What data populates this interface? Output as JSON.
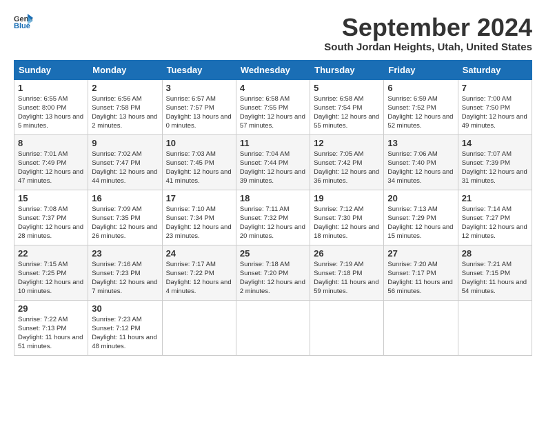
{
  "header": {
    "logo_general": "General",
    "logo_blue": "Blue",
    "month_title": "September 2024",
    "location": "South Jordan Heights, Utah, United States"
  },
  "weekdays": [
    "Sunday",
    "Monday",
    "Tuesday",
    "Wednesday",
    "Thursday",
    "Friday",
    "Saturday"
  ],
  "weeks": [
    [
      {
        "day": "1",
        "sunrise": "6:55 AM",
        "sunset": "8:00 PM",
        "daylight": "13 hours and 5 minutes."
      },
      {
        "day": "2",
        "sunrise": "6:56 AM",
        "sunset": "7:58 PM",
        "daylight": "13 hours and 2 minutes."
      },
      {
        "day": "3",
        "sunrise": "6:57 AM",
        "sunset": "7:57 PM",
        "daylight": "13 hours and 0 minutes."
      },
      {
        "day": "4",
        "sunrise": "6:58 AM",
        "sunset": "7:55 PM",
        "daylight": "12 hours and 57 minutes."
      },
      {
        "day": "5",
        "sunrise": "6:58 AM",
        "sunset": "7:54 PM",
        "daylight": "12 hours and 55 minutes."
      },
      {
        "day": "6",
        "sunrise": "6:59 AM",
        "sunset": "7:52 PM",
        "daylight": "12 hours and 52 minutes."
      },
      {
        "day": "7",
        "sunrise": "7:00 AM",
        "sunset": "7:50 PM",
        "daylight": "12 hours and 49 minutes."
      }
    ],
    [
      {
        "day": "8",
        "sunrise": "7:01 AM",
        "sunset": "7:49 PM",
        "daylight": "12 hours and 47 minutes."
      },
      {
        "day": "9",
        "sunrise": "7:02 AM",
        "sunset": "7:47 PM",
        "daylight": "12 hours and 44 minutes."
      },
      {
        "day": "10",
        "sunrise": "7:03 AM",
        "sunset": "7:45 PM",
        "daylight": "12 hours and 41 minutes."
      },
      {
        "day": "11",
        "sunrise": "7:04 AM",
        "sunset": "7:44 PM",
        "daylight": "12 hours and 39 minutes."
      },
      {
        "day": "12",
        "sunrise": "7:05 AM",
        "sunset": "7:42 PM",
        "daylight": "12 hours and 36 minutes."
      },
      {
        "day": "13",
        "sunrise": "7:06 AM",
        "sunset": "7:40 PM",
        "daylight": "12 hours and 34 minutes."
      },
      {
        "day": "14",
        "sunrise": "7:07 AM",
        "sunset": "7:39 PM",
        "daylight": "12 hours and 31 minutes."
      }
    ],
    [
      {
        "day": "15",
        "sunrise": "7:08 AM",
        "sunset": "7:37 PM",
        "daylight": "12 hours and 28 minutes."
      },
      {
        "day": "16",
        "sunrise": "7:09 AM",
        "sunset": "7:35 PM",
        "daylight": "12 hours and 26 minutes."
      },
      {
        "day": "17",
        "sunrise": "7:10 AM",
        "sunset": "7:34 PM",
        "daylight": "12 hours and 23 minutes."
      },
      {
        "day": "18",
        "sunrise": "7:11 AM",
        "sunset": "7:32 PM",
        "daylight": "12 hours and 20 minutes."
      },
      {
        "day": "19",
        "sunrise": "7:12 AM",
        "sunset": "7:30 PM",
        "daylight": "12 hours and 18 minutes."
      },
      {
        "day": "20",
        "sunrise": "7:13 AM",
        "sunset": "7:29 PM",
        "daylight": "12 hours and 15 minutes."
      },
      {
        "day": "21",
        "sunrise": "7:14 AM",
        "sunset": "7:27 PM",
        "daylight": "12 hours and 12 minutes."
      }
    ],
    [
      {
        "day": "22",
        "sunrise": "7:15 AM",
        "sunset": "7:25 PM",
        "daylight": "12 hours and 10 minutes."
      },
      {
        "day": "23",
        "sunrise": "7:16 AM",
        "sunset": "7:23 PM",
        "daylight": "12 hours and 7 minutes."
      },
      {
        "day": "24",
        "sunrise": "7:17 AM",
        "sunset": "7:22 PM",
        "daylight": "12 hours and 4 minutes."
      },
      {
        "day": "25",
        "sunrise": "7:18 AM",
        "sunset": "7:20 PM",
        "daylight": "12 hours and 2 minutes."
      },
      {
        "day": "26",
        "sunrise": "7:19 AM",
        "sunset": "7:18 PM",
        "daylight": "11 hours and 59 minutes."
      },
      {
        "day": "27",
        "sunrise": "7:20 AM",
        "sunset": "7:17 PM",
        "daylight": "11 hours and 56 minutes."
      },
      {
        "day": "28",
        "sunrise": "7:21 AM",
        "sunset": "7:15 PM",
        "daylight": "11 hours and 54 minutes."
      }
    ],
    [
      {
        "day": "29",
        "sunrise": "7:22 AM",
        "sunset": "7:13 PM",
        "daylight": "11 hours and 51 minutes."
      },
      {
        "day": "30",
        "sunrise": "7:23 AM",
        "sunset": "7:12 PM",
        "daylight": "11 hours and 48 minutes."
      },
      null,
      null,
      null,
      null,
      null
    ]
  ]
}
